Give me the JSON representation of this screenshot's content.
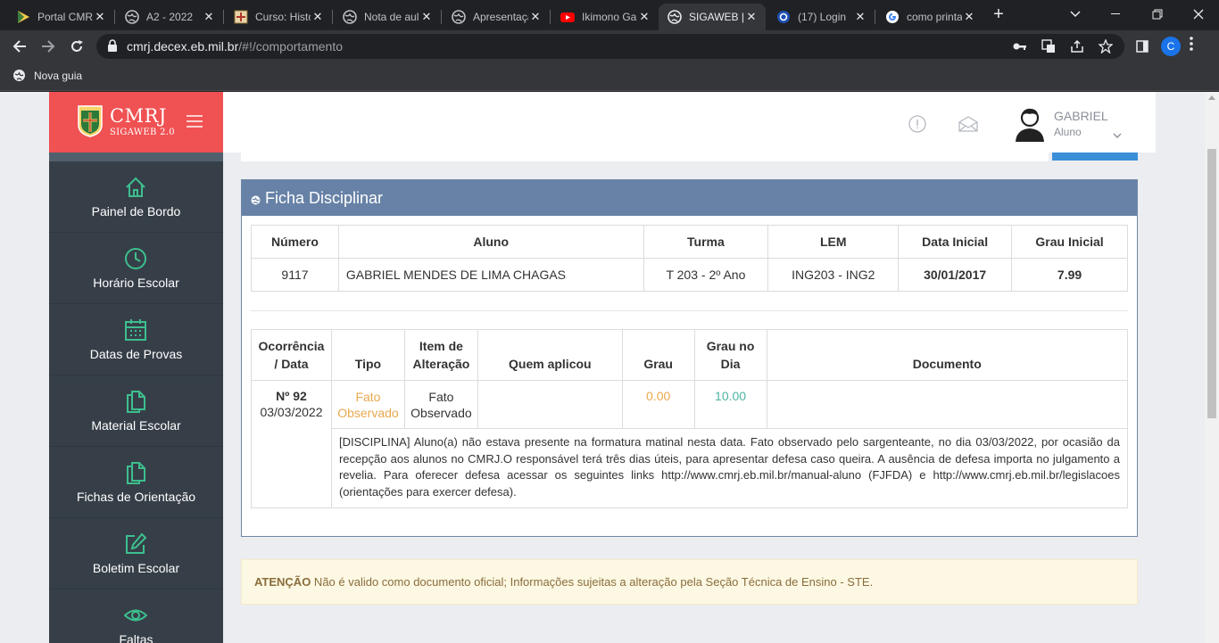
{
  "browser": {
    "tabs": [
      {
        "title": "Portal CMRJ",
        "icon": "play-triangle-icon"
      },
      {
        "title": "A2 - 2022",
        "icon": "globe-icon"
      },
      {
        "title": "Curso: História",
        "icon": "crest-icon"
      },
      {
        "title": "Nota de aula",
        "icon": "globe-icon"
      },
      {
        "title": "Apresentação",
        "icon": "globe-icon"
      },
      {
        "title": "Ikimono Gakari",
        "icon": "youtube-icon"
      },
      {
        "title": "SIGAWEB | C",
        "icon": "globe-icon",
        "active": true
      },
      {
        "title": "(17) Login",
        "icon": "circle-logo-icon"
      },
      {
        "title": "como printar",
        "icon": "google-icon"
      }
    ],
    "url_host": "cmrj.decex.eb.mil.br",
    "url_path": "/#!/comportamento",
    "profile_initial": "C",
    "bookmark_label": "Nova guia"
  },
  "brand": {
    "title": "CMRJ",
    "subtitle": "SIGAWEB 2.0",
    "color": "#f05152"
  },
  "user": {
    "name": "GABRIEL",
    "role": "Aluno"
  },
  "sidebar": {
    "items": [
      {
        "label": "Painel de Bordo",
        "icon": "home-icon"
      },
      {
        "label": "Horário Escolar",
        "icon": "clock-icon"
      },
      {
        "label": "Datas de Provas",
        "icon": "calendar-icon"
      },
      {
        "label": "Material Escolar",
        "icon": "document-icon"
      },
      {
        "label": "Fichas de Orientação",
        "icon": "document-icon"
      },
      {
        "label": "Boletim Escolar",
        "icon": "edit-icon"
      },
      {
        "label": "Faltas",
        "icon": "eye-icon"
      }
    ],
    "icon_color": "#3dbf8e"
  },
  "panel": {
    "title": "Ficha Disciplinar",
    "student_headers": [
      "Número",
      "Aluno",
      "Turma",
      "LEM",
      "Data Inicial",
      "Grau Inicial"
    ],
    "student_row": [
      "9117",
      "GABRIEL MENDES DE LIMA CHAGAS",
      "T 203 - 2º Ano",
      "ING203 - ING2",
      "30/01/2017",
      "7.99"
    ],
    "occurrence_headers": {
      "ocorrencia_line1": "Ocorrência",
      "ocorrencia_line2": "/ Data",
      "tipo": "Tipo",
      "item_line1": "Item de",
      "item_line2": "Alteração",
      "quem": "Quem aplicou",
      "grau": "Grau",
      "grau_dia_line1": "Grau no",
      "grau_dia_line2": "Dia",
      "documento": "Documento"
    },
    "occurrence": {
      "numero": "Nº 92",
      "data": "03/03/2022",
      "tipo_line1": "Fato",
      "tipo_line2": "Observado",
      "item_line1": "Fato",
      "item_line2": "Observado",
      "quem": "",
      "grau": "0.00",
      "grau_dia": "10.00",
      "documento": "",
      "descricao": "[DISCIPLINA] Aluno(a) não estava presente na formatura matinal nesta data. Fato observado pelo sargenteante, no dia 03/03/2022, por ocasião da recepção aos alunos no CMRJ.O responsável terá três dias úteis, para apresentar defesa caso queira. A ausência de defesa importa no julgamento a revelia. Para oferecer defesa acessar os seguintes links http://www.cmrj.eb.mil.br/manual-aluno (FJFDA) e http://www.cmrj.eb.mil.br/legislacoes (orientações para exercer defesa)."
    }
  },
  "notice": {
    "label": "ATENÇÃO",
    "text": " Não é valido como documento oficial; Informações sujeitas a alteração pela Seção Técnica de Ensino - STE."
  }
}
